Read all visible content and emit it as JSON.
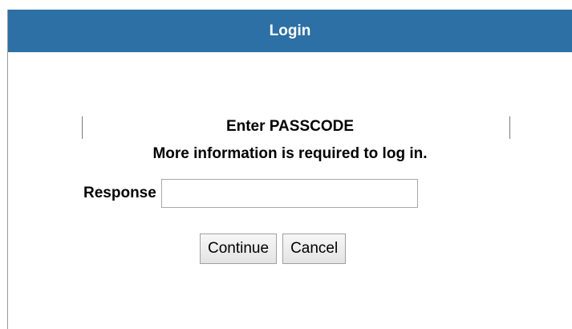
{
  "window": {
    "title": "Login"
  },
  "prompt": {
    "title": "Enter PASSCODE",
    "info": "More information is required to log in."
  },
  "form": {
    "response_label": "Response",
    "response_value": "",
    "continue_label": "Continue",
    "cancel_label": "Cancel"
  },
  "colors": {
    "title_bar": "#2c70a6",
    "title_text": "#ffffff"
  }
}
